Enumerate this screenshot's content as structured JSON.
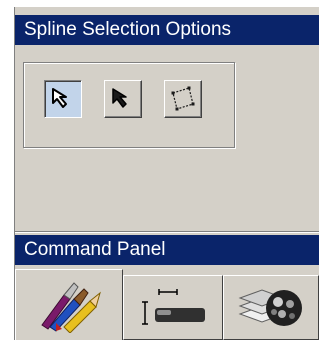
{
  "spline_panel": {
    "title": "Spline Selection Options",
    "buttons": [
      {
        "icon": "select-arrow-icon",
        "state": "pressed"
      },
      {
        "icon": "black-arrow-icon",
        "state": "normal"
      },
      {
        "icon": "bounding-box-icon",
        "state": "normal"
      }
    ]
  },
  "command_panel": {
    "title": "Command Panel",
    "tabs": [
      {
        "icon": "brushes-pencil-icon",
        "state": "active"
      },
      {
        "icon": "dimension-ruler-icon",
        "state": "normal"
      },
      {
        "icon": "layers-sphere-icon",
        "state": "normal"
      }
    ]
  },
  "colors": {
    "title_bar": "#0a246a",
    "panel_bg": "#d4d0c8",
    "pressed_button": "#c2d4ea"
  }
}
